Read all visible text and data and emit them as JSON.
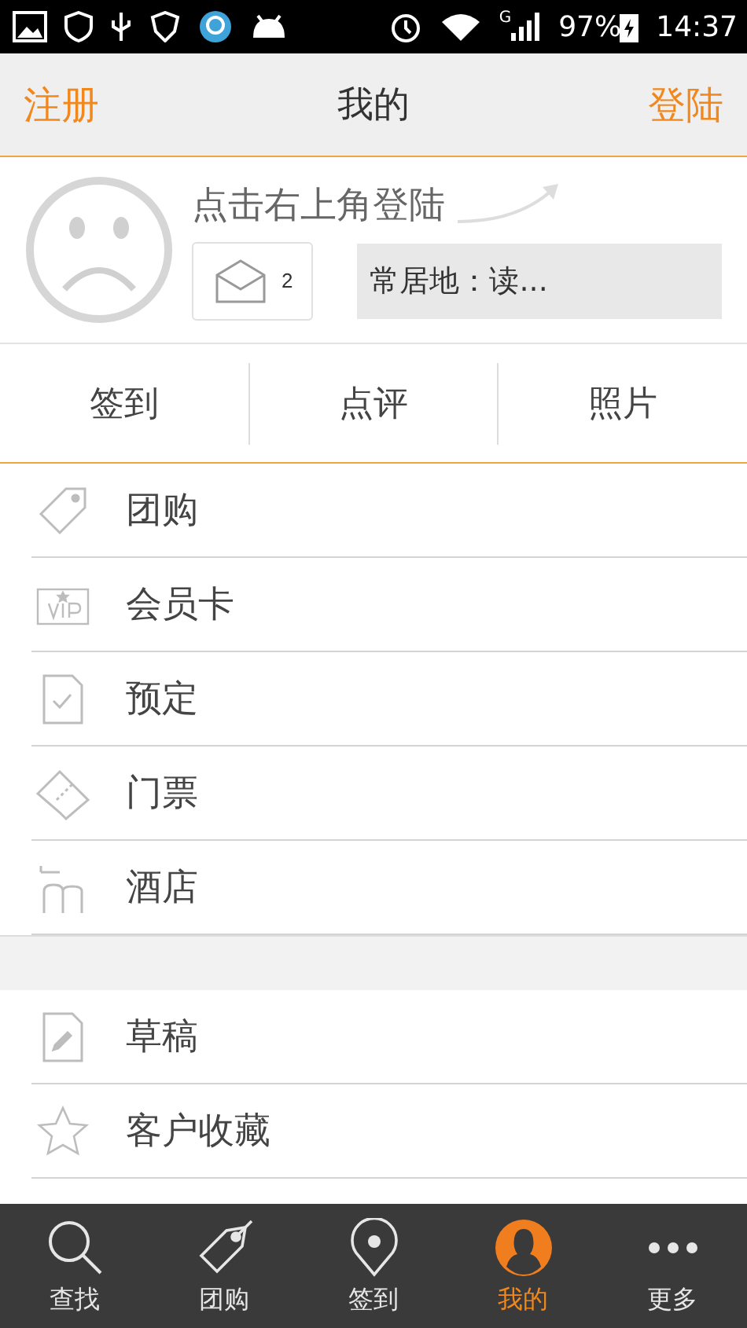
{
  "status_bar": {
    "network": "G",
    "battery": "97%",
    "time": "14:37"
  },
  "header": {
    "left": "注册",
    "title": "我的",
    "right": "登陆"
  },
  "profile": {
    "prompt": "点击右上角登陆",
    "messages": "2",
    "residence": "常居地：读..."
  },
  "stats": [
    {
      "label": "签到"
    },
    {
      "label": "点评"
    },
    {
      "label": "照片"
    }
  ],
  "sections": [
    {
      "items": [
        {
          "kind": "tag",
          "label": "团购"
        },
        {
          "kind": "vip",
          "label": "会员卡"
        },
        {
          "kind": "booking",
          "label": "预定"
        },
        {
          "kind": "ticket",
          "label": "门票"
        },
        {
          "kind": "hotel",
          "label": "酒店"
        }
      ]
    },
    {
      "items": [
        {
          "kind": "draft",
          "label": "草稿"
        },
        {
          "kind": "star",
          "label": "客户收藏"
        }
      ]
    }
  ],
  "tab_bar": [
    {
      "kind": "search",
      "label": "查找",
      "selected": false
    },
    {
      "kind": "tag",
      "label": "团购",
      "selected": false
    },
    {
      "kind": "pin",
      "label": "签到",
      "selected": false
    },
    {
      "kind": "person",
      "label": "我的",
      "selected": true
    },
    {
      "kind": "more",
      "label": "更多",
      "selected": false
    }
  ]
}
